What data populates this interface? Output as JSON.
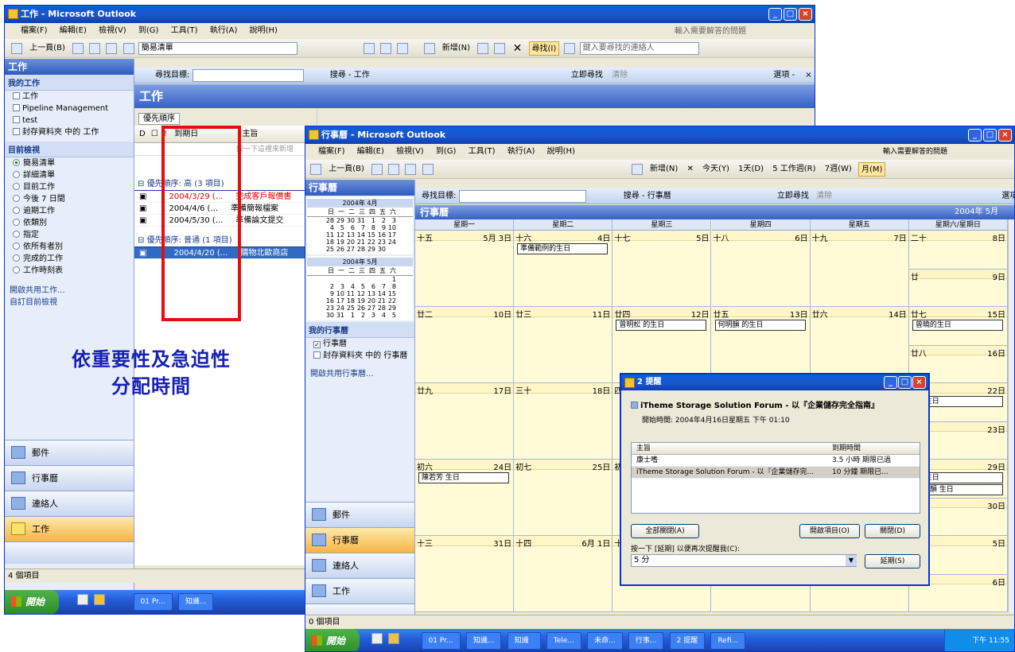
{
  "win1": {
    "title": "工作 - Microsoft Outlook",
    "menu": [
      "檔案(F)",
      "編輯(E)",
      "檢視(V)",
      "到(G)",
      "工具(T)",
      "執行(A)",
      "說明(H)"
    ],
    "help_box": "輸入需要解答的問題",
    "toolbar": {
      "back": "上一頁(B)",
      "view_select": "簡易清單",
      "find_btn": "尋找(I)",
      "contact_box": "鍵入要尋找的連絡人"
    },
    "findbar": {
      "label": "尋找目標:",
      "search_in": "搜尋 - 工作",
      "find_now": "立即尋找",
      "clear": "清除",
      "options": "選項 -"
    },
    "nav": {
      "header": "工作",
      "my_tasks_label": "我的工作",
      "my_tasks": [
        "工作",
        "Pipeline Management",
        "test",
        "封存資料夾 中的 工作"
      ],
      "current_view_label": "目前檢視",
      "views": [
        "簡易清單",
        "詳細清單",
        "目前工作",
        "今後 7 日間",
        "逾期工作",
        "依類別",
        "指定",
        "依所有者別",
        "完成的工作",
        "工作時刻表"
      ],
      "links": [
        "開啟共用工作...",
        "自訂目前檢視"
      ],
      "buttons": [
        "郵件",
        "行事曆",
        "連絡人",
        "工作"
      ]
    },
    "content": {
      "title": "工作",
      "sort_label": "優先順序",
      "columns": [
        "到期日",
        "主旨"
      ],
      "placeholder": "按一下這裡來新增",
      "group1": "優先順序: 高 (3 項目)",
      "group2": "優先順序: 普通 (1 項目)",
      "rows": [
        {
          "due": "2004/3/29 (...",
          "subject": "完成客戶報價書"
        },
        {
          "due": "2004/4/6 (...",
          "subject": "準備簡報檔案"
        },
        {
          "due": "2004/5/30 (...",
          "subject": "準備論文提交"
        }
      ],
      "row_normal": {
        "due": "2004/4/20 (...",
        "subject": "購物北歐商店"
      }
    },
    "status": "4 個項目",
    "overlay_text": [
      "依重要性及急迫性",
      "分配時間"
    ]
  },
  "taskbar1": {
    "start": "開始",
    "tasks": [
      "01 Pr...",
      "知識..."
    ]
  },
  "win2": {
    "title": "行事曆 - Microsoft Outlook",
    "menu": [
      "檔案(F)",
      "編輯(E)",
      "檢視(V)",
      "到(G)",
      "工具(T)",
      "執行(A)",
      "說明(H)"
    ],
    "help_box": "輸入需要解答的問題",
    "toolbar": {
      "back": "上一頁(B)",
      "new": "新增(N)",
      "today": "今天(Y)",
      "day": "1天(D)",
      "workweek": "5 工作週(R)",
      "week": "7週(W)",
      "month": "月(M)"
    },
    "findbar": {
      "label": "尋找目標:",
      "search_in": "搜尋 - 行事曆",
      "find_now": "立即尋找",
      "clear": "清除",
      "options": "選項 -"
    },
    "nav": {
      "header": "行事曆",
      "mini1": {
        "title": "2004年 4月",
        "days": [
          "日",
          "一",
          "二",
          "三",
          "四",
          "五",
          "六"
        ],
        "rows": [
          [
            "28",
            "29",
            "30",
            "31",
            "1",
            "2",
            "3"
          ],
          [
            "4",
            "5",
            "6",
            "7",
            "8",
            "9",
            "10"
          ],
          [
            "11",
            "12",
            "13",
            "14",
            "15",
            "16",
            "17"
          ],
          [
            "18",
            "19",
            "20",
            "21",
            "22",
            "23",
            "24"
          ],
          [
            "25",
            "26",
            "27",
            "28",
            "29",
            "30",
            ""
          ]
        ]
      },
      "mini2": {
        "title": "2004年 5月",
        "days": [
          "日",
          "一",
          "二",
          "三",
          "四",
          "五",
          "六"
        ],
        "rows": [
          [
            "",
            "",
            "",
            "",
            "",
            "",
            "1"
          ],
          [
            "2",
            "3",
            "4",
            "5",
            "6",
            "7",
            "8"
          ],
          [
            "9",
            "10",
            "11",
            "12",
            "13",
            "14",
            "15"
          ],
          [
            "16",
            "17",
            "18",
            "19",
            "20",
            "21",
            "22"
          ],
          [
            "23",
            "24",
            "25",
            "26",
            "27",
            "28",
            "29"
          ],
          [
            "30",
            "31",
            "1",
            "2",
            "3",
            "4",
            "5"
          ]
        ]
      },
      "my_cal_label": "我的行事曆",
      "calendars": [
        "行事曆",
        "封存資料夾 中的 行事曆"
      ],
      "link": "開啟共用行事曆...",
      "buttons": [
        "郵件",
        "行事曆",
        "連絡人",
        "工作"
      ]
    },
    "cal": {
      "title": "行事曆",
      "month_label": "2004年 5月",
      "weekdays": [
        "星期一",
        "星期二",
        "星期三",
        "星期四",
        "星期五",
        "星期六/星期日"
      ],
      "weeks": [
        [
          {
            "l": "十五",
            "r": "5月 3日"
          },
          {
            "l": "十六",
            "r": "4日"
          },
          {
            "l": "十七",
            "r": "5日"
          },
          {
            "l": "十八",
            "r": "6日"
          },
          {
            "l": "十九",
            "r": "7日"
          },
          {
            "l": "二十",
            "r": "8日",
            "l2": "廿",
            "r2": "9日"
          }
        ],
        [
          {
            "l": "廿二",
            "r": "10日"
          },
          {
            "l": "廿三",
            "r": "11日"
          },
          {
            "l": "廿四",
            "r": "12日"
          },
          {
            "l": "廿五",
            "r": "13日"
          },
          {
            "l": "廿六",
            "r": "14日"
          },
          {
            "l": "廿七",
            "r": "15日",
            "l2": "廿八",
            "r2": "16日"
          }
        ],
        [
          {
            "l": "廿九",
            "r": "17日"
          },
          {
            "l": "三十",
            "r": "18日"
          },
          {
            "l": "四",
            "r": "19日"
          },
          {
            "l": "",
            "r": ""
          },
          {
            "l": "",
            "r": ""
          },
          {
            "l": "",
            "r": "22日",
            "l2": "",
            "r2": "23日"
          }
        ],
        [
          {
            "l": "初六",
            "r": "24日"
          },
          {
            "l": "初七",
            "r": "25日"
          },
          {
            "l": "初",
            "r": ""
          },
          {
            "l": "",
            "r": ""
          },
          {
            "l": "",
            "r": ""
          },
          {
            "l": "",
            "r": "29日",
            "l2": "",
            "r2": "30日"
          }
        ],
        [
          {
            "l": "十三",
            "r": "31日"
          },
          {
            "l": "十四",
            "r": "6月 1日"
          },
          {
            "l": "十",
            "r": ""
          },
          {
            "l": "",
            "r": ""
          },
          {
            "l": "",
            "r": ""
          },
          {
            "l": "",
            "r": "5日",
            "l2": "",
            "r2": "6日"
          }
        ]
      ],
      "events": {
        "e1": "準備範例的生日",
        "e2": "曾明松 的生日",
        "e3": "何明韻 的生日",
        "e4": "曾曉的生日",
        "e5": "何韻的生日",
        "e6": "陳若芳 生日",
        "e7": "曾 生日",
        "e8": "何 生日",
        "e9": "何明韻 生日"
      }
    },
    "dialog": {
      "title": "2 提醒",
      "headline": "iTheme Storage Solution Forum - 以『企業儲存完全指南』",
      "start": "開始時間: 2004年4月16日星期五 下午 01:10",
      "col_subject": "主旨",
      "col_due": "到期時間",
      "items": [
        {
          "s": "康士嗜",
          "d": "3.5 小時 期限已過"
        },
        {
          "s": "iTheme Storage Solution Forum - 以『企業儲存完...",
          "d": "10 分鐘 期限已..."
        }
      ],
      "dismiss_all": "全部關閉(A)",
      "open_item": "開啟項目(O)",
      "dismiss": "關閉(D)",
      "snooze_label": "按一下 [延期] 以便再次提醒我(C):",
      "snooze_value": "5 分",
      "snooze_btn": "延期(S)"
    },
    "status": "0 個項目"
  },
  "taskbar2": {
    "start": "開始",
    "tasks": [
      "01 Pr...",
      "知識...",
      "知識",
      "Tele...",
      "未命...",
      "行事...",
      "2 提醒",
      "Refi..."
    ],
    "tray": "下午 11:55"
  }
}
